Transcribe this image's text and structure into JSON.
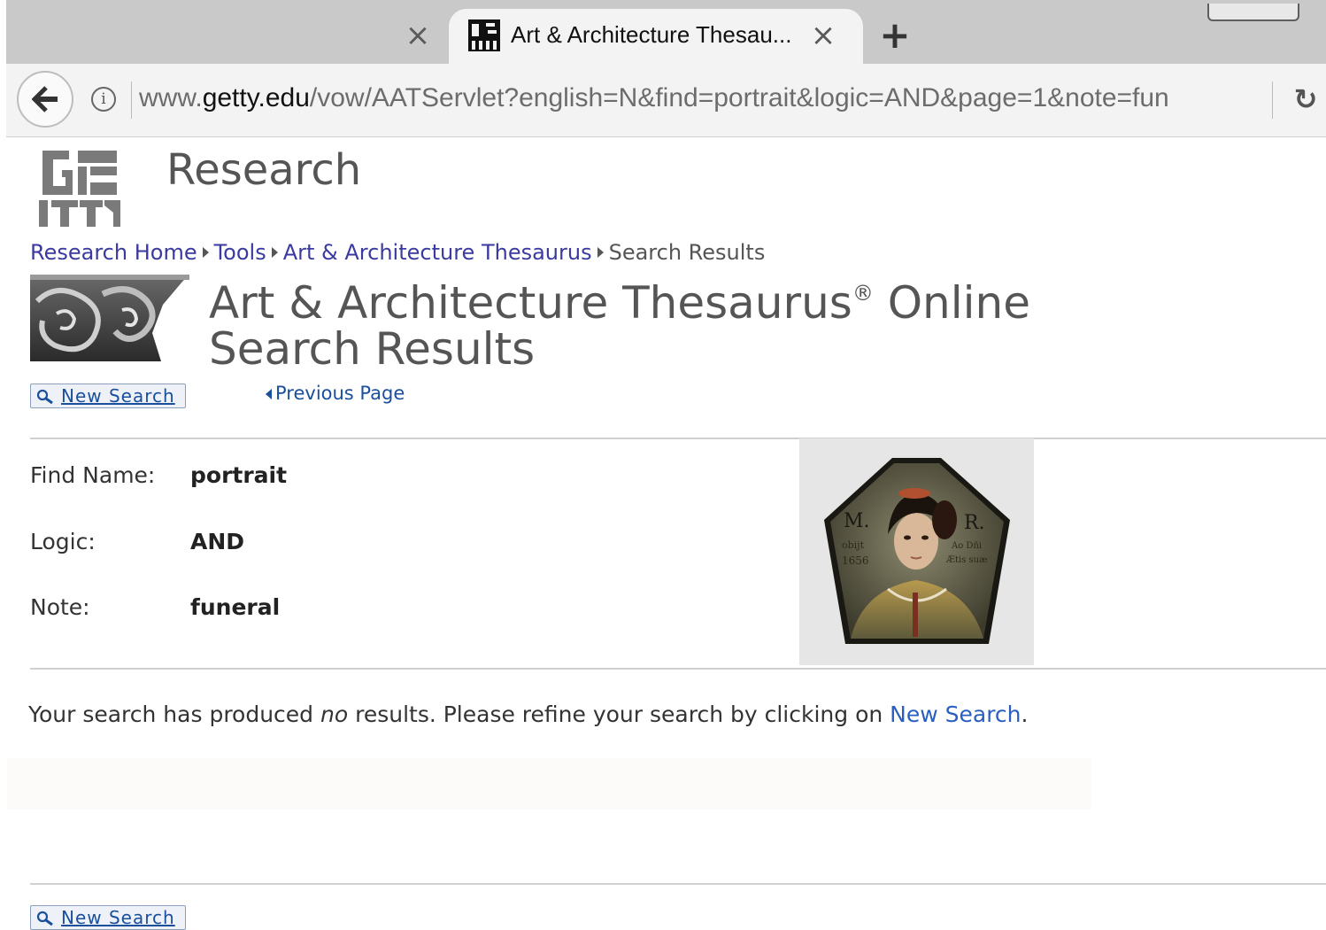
{
  "browser": {
    "tab_inactive_close": "×",
    "tab_active_title": "Art & Architecture Thesau...",
    "tab_close": "×",
    "new_tab": "+",
    "url_prefix": "www.",
    "url_host": "getty.edu",
    "url_path": "/vow/AATServlet?english=N&find=portrait&logic=AND&page=1&note=fun"
  },
  "header": {
    "section_title": "Research"
  },
  "breadcrumb": {
    "items": [
      "Research Home",
      "Tools",
      "Art & Architecture Thesaurus"
    ],
    "current": "Search Results"
  },
  "title": {
    "line1": "Art & Architecture Thesaurus",
    "mark": "®",
    "line1_suffix": " Online",
    "line2": "Search Results"
  },
  "toolbar": {
    "new_search_label": "New Search",
    "previous_page_label": "Previous Page"
  },
  "criteria": [
    {
      "label": "Find Name:",
      "value": "portrait"
    },
    {
      "label": "Logic:",
      "value": "AND"
    },
    {
      "label": "Note:",
      "value": "funeral"
    }
  ],
  "results": {
    "message_before": "Your search has produced ",
    "message_em": "no",
    "message_after": " results. Please refine your search by clicking on ",
    "message_link": "New Search",
    "message_end": "."
  },
  "footer": {
    "new_search_label": "New Search"
  },
  "colors": {
    "link": "#3a3aa0",
    "heading": "#555555",
    "tab_strip": "#c9c9c9"
  }
}
